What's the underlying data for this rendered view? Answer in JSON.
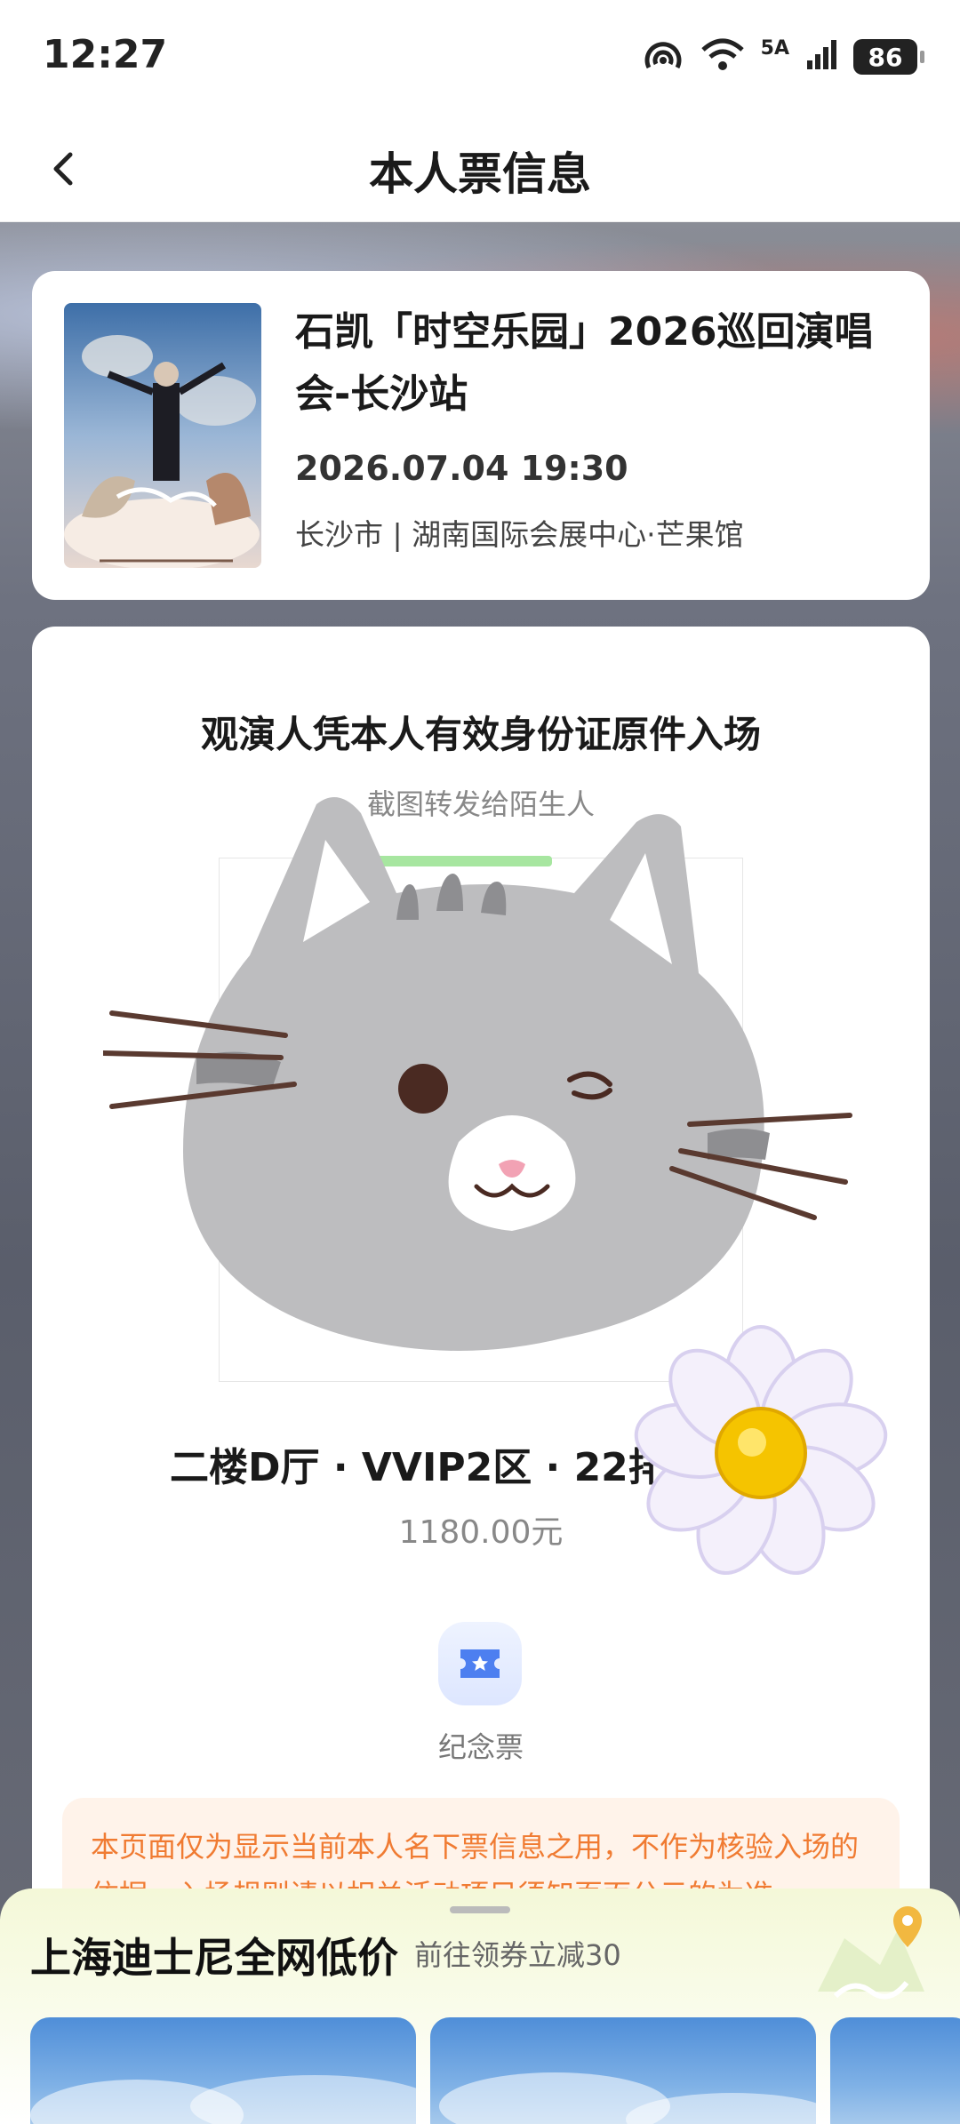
{
  "status_bar": {
    "time": "12:27",
    "network_label": "5A",
    "battery": "86"
  },
  "header": {
    "title": "本人票信息"
  },
  "event": {
    "title": "石凯「时空乐园」2026巡回演唱会-长沙站",
    "datetime": "2026.07.04 19:30",
    "venue": "长沙市 | 湖南国际会展中心·芒果馆"
  },
  "ticket": {
    "id_notice": "观演人凭本人有效身份证原件入场",
    "screenshot_notice": "截图转发给陌生人",
    "seat": "二楼D厅 · VVIP2区 · 22排",
    "price": "1180.00元",
    "souvenir_label": "纪念票",
    "disclaimer": "本页面仅为显示当前本人名下票信息之用，不作为核验入场的依据，入场规则请以相关活动项目须知页面公示的为准"
  },
  "bottom_ad": {
    "title": "上海迪士尼全网低价",
    "subtitle": "前往领券立减30"
  },
  "colors": {
    "accent_orange": "#f07b32",
    "disclaimer_bg": "#fff3ea",
    "souvenir_blue": "#4d7ff0"
  }
}
